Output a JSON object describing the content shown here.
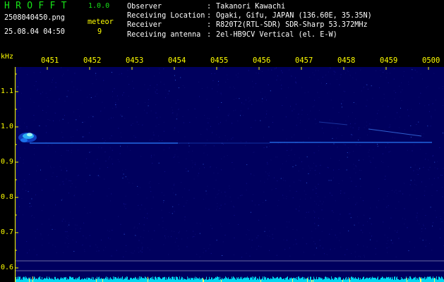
{
  "app": {
    "title": "HROFFT",
    "version": "1.0.0"
  },
  "file": {
    "name": "2508040450.png",
    "datetime": "25.08.04 04:50"
  },
  "meteor": {
    "label": "meteor",
    "count": "9"
  },
  "station": [
    {
      "label": "Observer",
      "sep": ":",
      "value": "Takanori Kawachi"
    },
    {
      "label": "Receiving Location",
      "sep": ":",
      "value": "Ogaki, Gifu, JAPAN (136.60E, 35.35N)"
    },
    {
      "label": "Receiver",
      "sep": ":",
      "value": "R820T2(RTL-SDR) SDR-Sharp 53.372MHz"
    },
    {
      "label": "Receiving antenna",
      "sep": ":",
      "value": "2el-HB9CV Vertical (el. E-W)"
    }
  ],
  "spectrogram": {
    "freq_unit": "kHz",
    "time_ticks": [
      "0451",
      "0452",
      "0453",
      "0454",
      "0455",
      "0456",
      "0457",
      "0458",
      "0459",
      "0500"
    ],
    "freq_ticks": [
      "1.1",
      "1.0",
      "0.9",
      "0.8",
      "0.7",
      "0.6"
    ],
    "colors": {
      "background": "#000066",
      "axis": "#ffff00",
      "trace": "#00ccff",
      "noise_floor": "#00e5ff",
      "title_green": "#18e418",
      "label_yellow": "#ffff00"
    }
  }
}
